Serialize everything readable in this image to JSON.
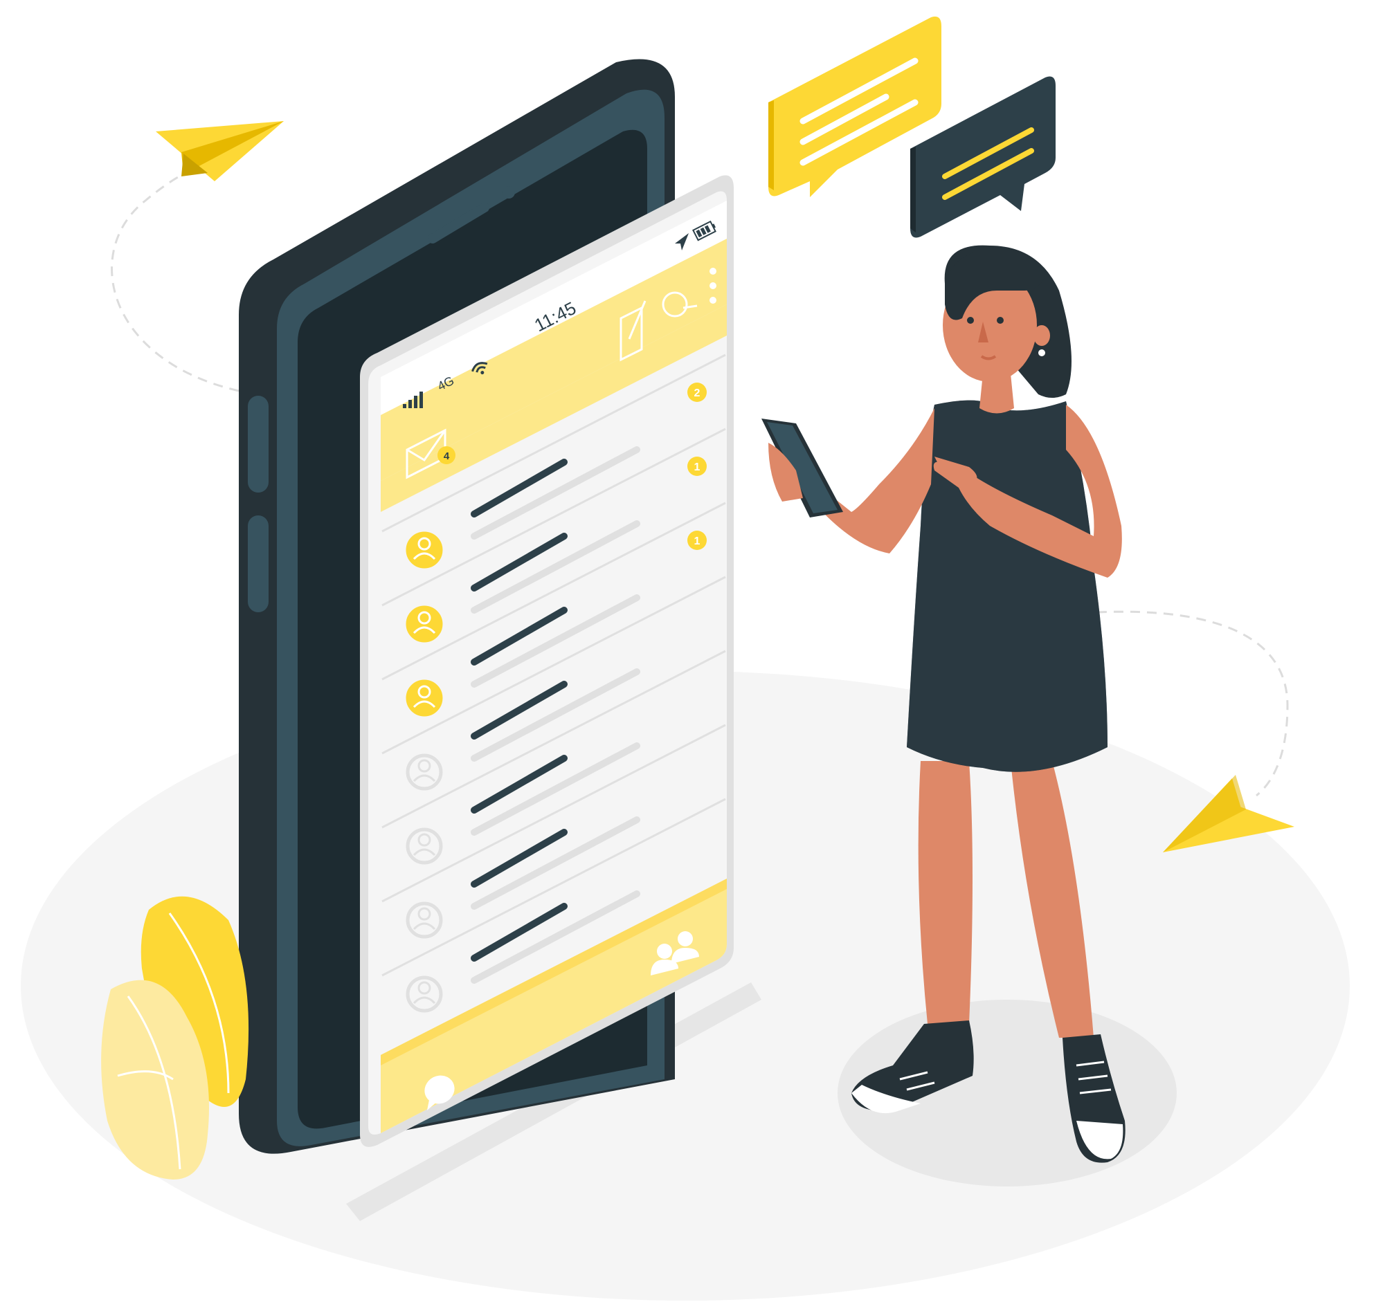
{
  "status_bar": {
    "network": "4G",
    "time": "11:45"
  },
  "inbox": {
    "unread_count": "4"
  },
  "conversations": [
    {
      "avatar": "user-icon",
      "badge": "2",
      "active": true
    },
    {
      "avatar": "user-icon",
      "badge": "1",
      "active": true
    },
    {
      "avatar": "user-icon",
      "badge": "1",
      "active": true
    },
    {
      "avatar": "user-icon",
      "badge": "",
      "active": false
    },
    {
      "avatar": "user-icon",
      "badge": "",
      "active": false
    },
    {
      "avatar": "user-icon",
      "badge": "",
      "active": false
    },
    {
      "avatar": "user-icon",
      "badge": "",
      "active": false
    }
  ],
  "icons": {
    "status": [
      "signal-icon",
      "wifi-icon",
      "location-arrow-icon",
      "battery-icon"
    ],
    "header": [
      "compose-icon",
      "search-icon",
      "more-vertical-icon",
      "mail-icon"
    ],
    "footer": [
      "chat-bubble-icon",
      "contacts-icon"
    ]
  },
  "colors": {
    "accent_yellow": "#fdd835",
    "light_yellow": "#fde88a",
    "dark_slate": "#2d4049",
    "phone_body": "#263238",
    "skin": "#de8868",
    "screen_bg": "#f5f5f5"
  }
}
